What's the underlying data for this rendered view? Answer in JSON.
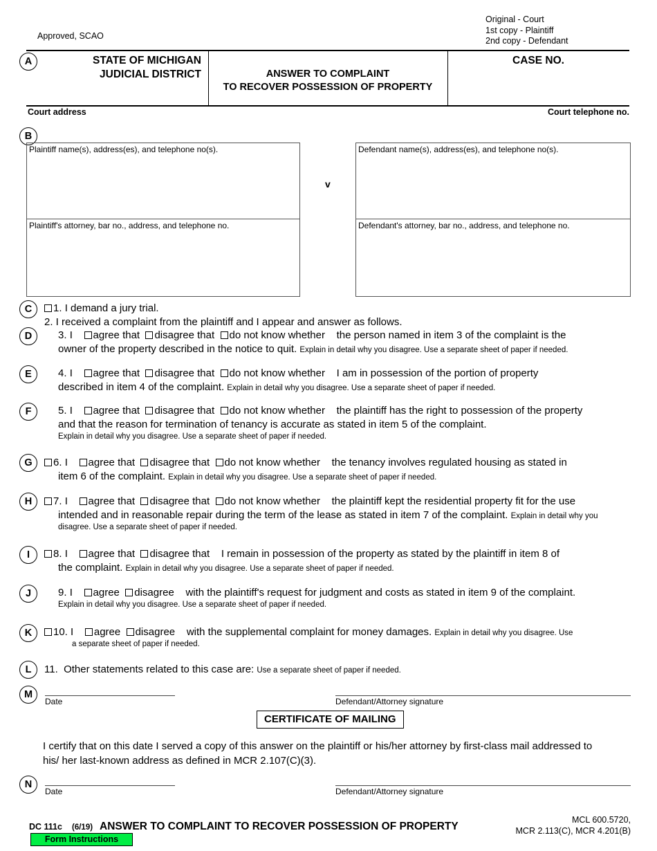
{
  "document": {
    "approved_note": "Approved, SCAO",
    "copies": [
      "Original - Court",
      "1st copy - Plaintiff",
      "2nd copy - Defendant"
    ]
  },
  "header": {
    "marker": "A",
    "state_line1": "STATE OF MICHIGAN",
    "state_line2": "JUDICIAL DISTRICT",
    "form_title_line1": "ANSWER TO COMPLAINT",
    "form_title_line2": "TO RECOVER POSSESSION OF PROPERTY",
    "case_no_label": "CASE NO.",
    "court_address_label": "Court address",
    "court_telephone_label": "Court telephone no."
  },
  "parties": {
    "marker": "B",
    "versus": "v",
    "plaintiff_label": "Plaintiff name(s), address(es), and telephone no(s).",
    "defendant_label": "Defendant name(s), address(es), and telephone no(s).",
    "plaintiff_attorney_label": "Plaintiff's attorney, bar no., address, and telephone no.",
    "defendant_attorney_label": "Defendant's attorney, bar no., address, and telephone no."
  },
  "options": {
    "agree_that": "agree that",
    "disagree_that": "disagree that",
    "do_not_know": "do not know whether",
    "agree": "agree",
    "disagree": "disagree"
  },
  "explain_note": "Explain in detail why you disagree. Use a separate sheet of paper if needed.",
  "items": {
    "c": {
      "marker": "C",
      "item1_number": "1.",
      "item1_text": "I demand a jury trial.",
      "item2_text": "2. I received a complaint from the plaintiff and I appear and answer as follows."
    },
    "d": {
      "marker": "D",
      "number": "3.",
      "lead": "I",
      "tail": "the person named in item 3 of the complaint is the",
      "line2": "owner of the property described in the notice to quit."
    },
    "e": {
      "marker": "E",
      "number": "4.",
      "lead": "I",
      "tail": "I am in possession of the portion of property",
      "line2": "described in item 4 of the complaint."
    },
    "f": {
      "marker": "F",
      "number": "5.",
      "lead": "I",
      "tail": "the plaintiff has the right to possession of the property",
      "line2": "and that the reason for termination of tenancy is accurate as stated in item 5 of the complaint."
    },
    "g": {
      "marker": "G",
      "number": "6.",
      "lead": "I",
      "tail": "the tenancy involves regulated housing as stated in",
      "line2": "item 6 of the complaint."
    },
    "h": {
      "marker": "H",
      "number": "7.",
      "lead": "I",
      "tail": "the plaintiff kept the residential property fit for the use",
      "line2": "intended and in reasonable repair during the term of the lease as stated in item 7 of the complaint.",
      "note_line1": "Explain in detail why you",
      "note_line2": "disagree. Use a separate sheet of paper if needed."
    },
    "i": {
      "marker": "I",
      "number": "8.",
      "lead": "I",
      "tail": "I remain in possession of the property as stated by the plaintiff in item 8 of",
      "line2": "the complaint."
    },
    "j": {
      "marker": "J",
      "number": "9.",
      "lead": "I",
      "tail": "with the plaintiff's request for judgment and costs as stated in item 9 of the complaint."
    },
    "k": {
      "marker": "K",
      "number": "10.",
      "lead": "I",
      "tail": "with the supplemental complaint for money damages.",
      "note_line1": "Explain in detail why you disagree. Use",
      "note_line2": "a separate sheet of paper if needed."
    },
    "l": {
      "marker": "L",
      "number": "11.",
      "text": "Other statements related to this case are:",
      "note": "Use a separate sheet of paper if needed."
    }
  },
  "signature_block_1": {
    "marker": "M",
    "date_label": "Date",
    "signature_label": "Defendant/Attorney signature"
  },
  "certificate": {
    "heading": "CERTIFICATE OF MAILING",
    "body_line1": "I certify that on this date I served a copy of this answer on the plaintiff or his/her attorney by first-class mail addressed to",
    "body_line2": "his/ her last-known address as defined in MCR 2.107(C)(3)."
  },
  "signature_block_2": {
    "marker": "N",
    "date_label": "Date",
    "signature_label": "Defendant/Attorney signature"
  },
  "footer": {
    "form_code": "DC 111c",
    "revision": "(6/19)",
    "title": "ANSWER TO COMPLAINT TO RECOVER POSSESSION OF PROPERTY",
    "citation_line1": "MCL 600.5720,",
    "citation_line2": "MCR 2.113(C), MCR 4.201(B)",
    "instructions_button": "Form Instructions",
    "instructions_button_color": "#00EE44"
  }
}
